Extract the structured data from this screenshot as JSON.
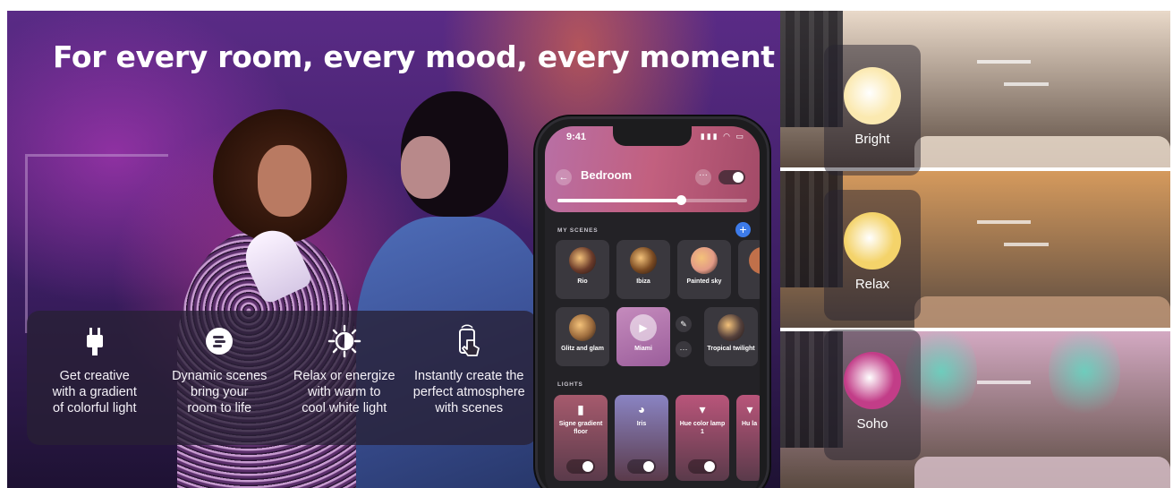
{
  "headline": "For every room, every mood, every moment",
  "features": [
    {
      "icon": "gradient-lightstrip-icon",
      "text": "Get creative\nwith a gradient\nof colorful light"
    },
    {
      "icon": "dynamic-scenes-icon",
      "text": "Dynamic scenes\nbring your\nroom to life"
    },
    {
      "icon": "sun-moon-icon",
      "text": "Relax or energize\nwith warm to\ncool white light"
    },
    {
      "icon": "phone-tap-icon",
      "text": "Instantly create the\nperfect atmosphere\nwith scenes"
    }
  ],
  "phone": {
    "time": "9:41",
    "room": "Bedroom",
    "brightness": 0.65,
    "my_scenes_label": "MY SCENES",
    "scenes": [
      {
        "name": "Rio",
        "color": "#6b3b2a"
      },
      {
        "name": "Ibiza",
        "color": "#7a4a22"
      },
      {
        "name": "Painted sky",
        "color": "#e29a86"
      },
      {
        "name": "Glitz and glam",
        "color": "#9b6a3c"
      },
      {
        "name": "Miami",
        "color": "#c58bbd"
      },
      {
        "name": "Tropical twilight",
        "color": "#55413c"
      }
    ],
    "lights_label": "LIGHTS",
    "lights": [
      {
        "name": "Signe gradient floor",
        "color": "#a65a6d"
      },
      {
        "name": "Iris",
        "color": "#8a84c3"
      },
      {
        "name": "Hue color lamp 1",
        "color": "#b9557a"
      },
      {
        "name": "Hu la",
        "color": "#b9557a"
      }
    ]
  },
  "moods": [
    {
      "name": "Bright",
      "orb_color": "#fbe9b0",
      "wall": "#e9d9c9"
    },
    {
      "name": "Relax",
      "orb_color": "#f4d36a",
      "wall": "#d59a5d"
    },
    {
      "name": "Soho",
      "orb_color": "#c23d88",
      "wall": "#d3a9c2"
    }
  ]
}
